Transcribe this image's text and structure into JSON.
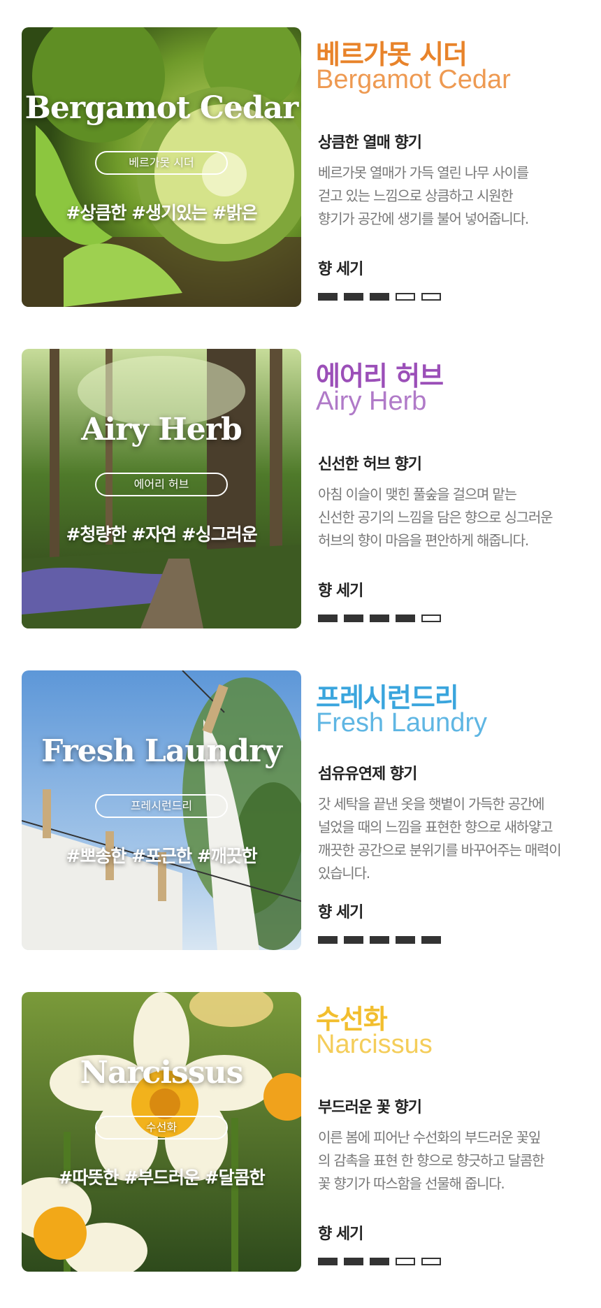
{
  "products": [
    {
      "thumb_title": "Bergamot Cedar",
      "thumb_pill": "베르가못 시더",
      "thumb_tags": "#상큼한 #생기있는 #밝은",
      "name_ko": "베르가못 시더",
      "name_en": "Bergamot Cedar",
      "name_color": "#E8832A",
      "name_en_color": "#EE9A52",
      "subtitle": "상큼한 열매 향기",
      "desc_lines": [
        "베르가못 열매가 가득 열린 나무 사이를",
        "걷고 있는 느낌으로 상큼하고 시원한",
        "향기가 공간에 생기를 불어 넣어줍니다."
      ],
      "strength_label": "향 세기",
      "strength": 3,
      "strength_max": 5
    },
    {
      "thumb_title": "Airy Herb",
      "thumb_pill": "에어리 허브",
      "thumb_tags": "#청량한 #자연 #싱그러운",
      "name_ko": "에어리 허브",
      "name_en": "Airy Herb",
      "name_color": "#9B4FB8",
      "name_en_color": "#B07AC8",
      "subtitle": "신선한 허브 향기",
      "desc_lines": [
        "아침 이슬이 맺힌 풀숲을 걸으며 맡는",
        "신선한 공기의 느낌을 담은 향으로 싱그러운",
        "허브의 향이 마음을 편안하게 해줍니다."
      ],
      "strength_label": "향 세기",
      "strength": 4,
      "strength_max": 5
    },
    {
      "thumb_title": "Fresh Laundry",
      "thumb_pill": "프레시런드리",
      "thumb_tags": "#뽀송한 #포근한 #깨끗한",
      "name_ko": "프레시런드리",
      "name_en": "Fresh Laundry",
      "name_color": "#3AA5DD",
      "name_en_color": "#5FB6E3",
      "subtitle": "섬유유연제 향기",
      "desc_lines": [
        "갓 세탁을 끝낸 옷을 햇볕이 가득한 공간에",
        "널었을 때의 느낌을 표현한 향으로 새하얗고",
        "깨끗한 공간으로 분위기를 바꾸어주는 매력이",
        "있습니다."
      ],
      "strength_label": "향 세기",
      "strength": 5,
      "strength_max": 5
    },
    {
      "thumb_title": "Narcissus",
      "thumb_pill": "수선화",
      "thumb_tags": "#따뜻한 #부드러운 #달콤한",
      "name_ko": "수선화",
      "name_en": "Narcissus",
      "name_color": "#F2BE2E",
      "name_en_color": "#F4CD5A",
      "subtitle": "부드러운 꽃 향기",
      "desc_lines": [
        "이른 봄에 피어난 수선화의 부드러운 꽃잎",
        "의 감촉을 표현 한 향으로 향긋하고 달콤한",
        "꽃 향기가 따스함을 선물해 줍니다."
      ],
      "strength_label": "향 세기",
      "strength": 3,
      "strength_max": 5
    }
  ]
}
